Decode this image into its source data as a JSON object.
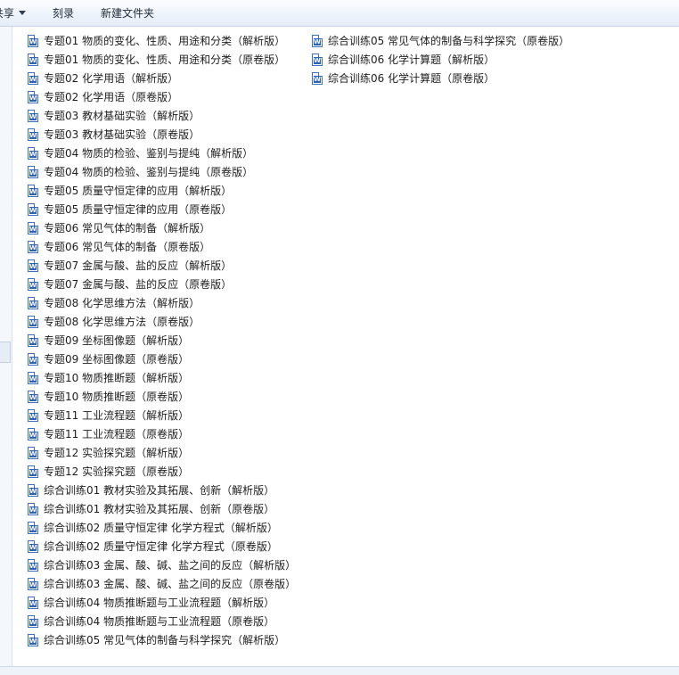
{
  "toolbar": {
    "share_label": "共享",
    "burn_label": "刻录",
    "new_folder_label": "新建文件夹"
  },
  "icons": {
    "file": "word-document-icon"
  },
  "colors": {
    "toolbar_bg": "#eef4fb",
    "icon_blue": "#2b62b8"
  },
  "files": {
    "column1": [
      "专题01 物质的变化、性质、用途和分类（解析版）",
      "专题01 物质的变化、性质、用途和分类（原卷版）",
      "专题02 化学用语（解析版）",
      "专题02 化学用语（原卷版）",
      "专题03 教材基础实验（解析版）",
      "专题03 教材基础实验（原卷版）",
      "专题04  物质的检验、鉴别与提纯（解析版）",
      "专题04  物质的检验、鉴别与提纯（原卷版）",
      "专题05  质量守恒定律的应用（解析版）",
      "专题05  质量守恒定律的应用（原卷版）",
      "专题06  常见气体的制备（解析版）",
      "专题06  常见气体的制备（原卷版）",
      "专题07  金属与酸、盐的反应（解析版）",
      "专题07  金属与酸、盐的反应（原卷版）",
      "专题08  化学思维方法（解析版）",
      "专题08  化学思维方法（原卷版）",
      "专题09  坐标图像题（解析版）",
      "专题09  坐标图像题（原卷版）",
      "专题10  物质推断题（解析版）",
      "专题10  物质推断题（原卷版）",
      "专题11  工业流程题（解析版）",
      "专题11  工业流程题（原卷版）",
      "专题12  实验探究题（解析版）",
      "专题12  实验探究题（原卷版）",
      "综合训练01 教材实验及其拓展、创新（解析版）",
      "综合训练01 教材实验及其拓展、创新（原卷版）",
      "综合训练02 质量守恒定律 化学方程式（解析版）",
      "综合训练02 质量守恒定律 化学方程式（原卷版）",
      "综合训练03 金属、酸、碱、盐之间的反应（解析版）",
      "综合训练03 金属、酸、碱、盐之间的反应（原卷版）",
      "综合训练04 物质推断题与工业流程题（解析版）",
      "综合训练04 物质推断题与工业流程题（原卷版）",
      "综合训练05 常见气体的制备与科学探究（解析版）"
    ],
    "column2": [
      "综合训练05 常见气体的制备与科学探究（原卷版）",
      "综合训练06 化学计算题（解析版）",
      "综合训练06 化学计算题（原卷版）"
    ]
  }
}
